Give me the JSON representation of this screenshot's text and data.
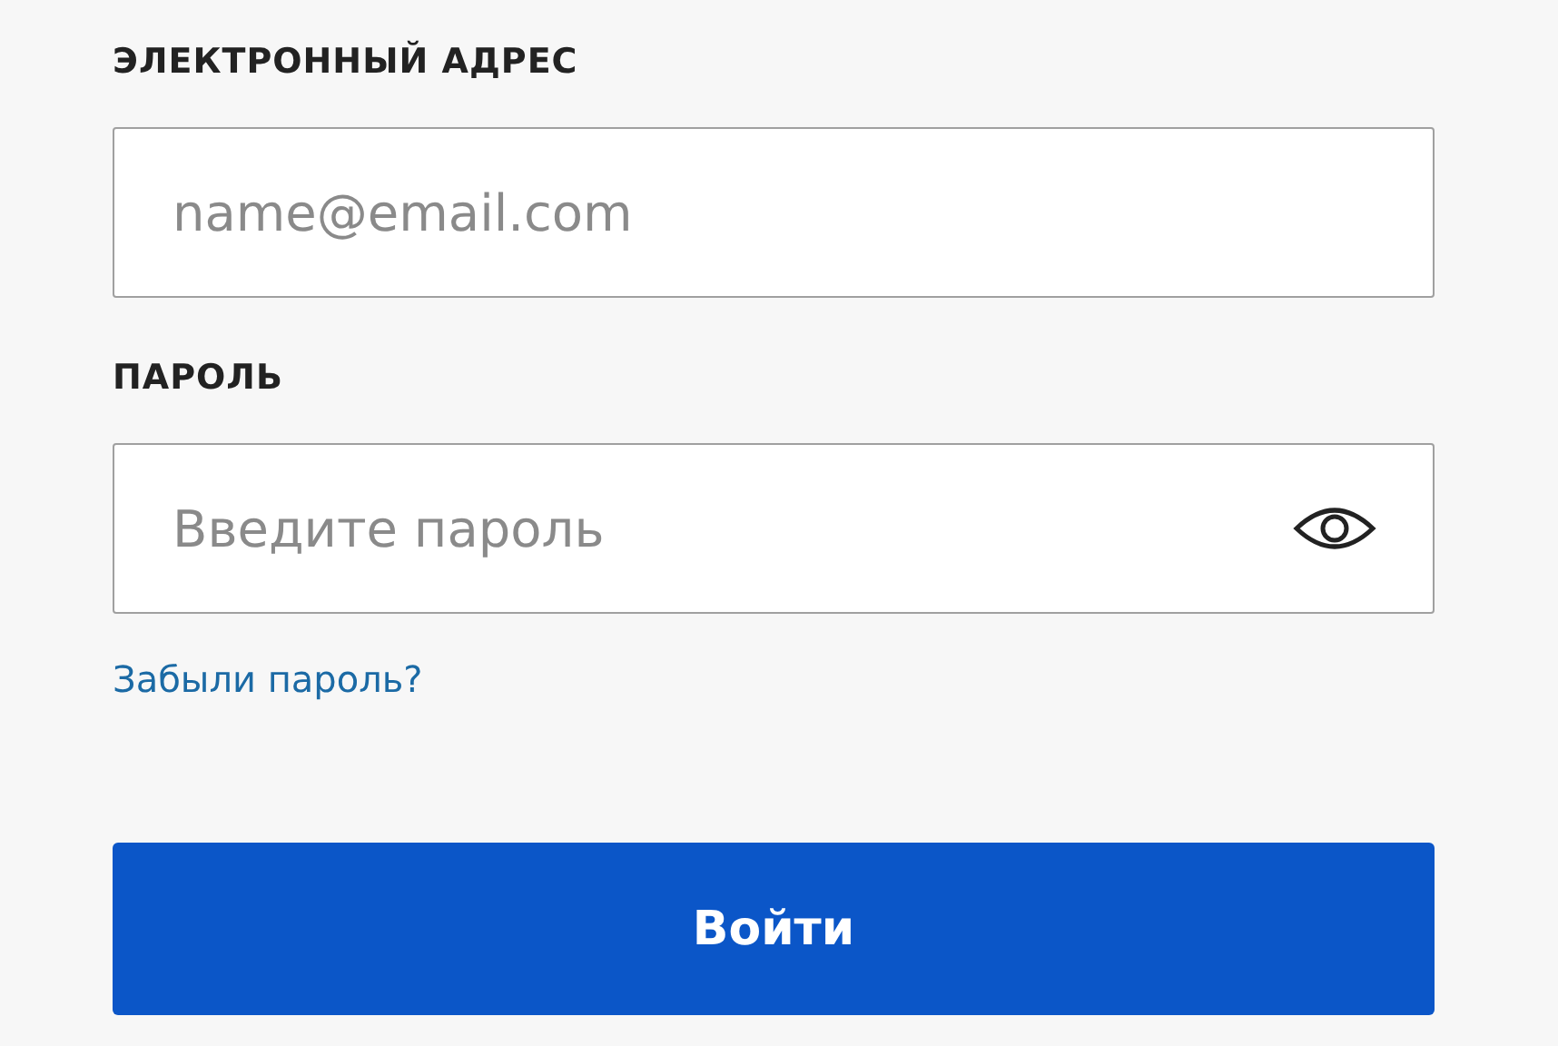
{
  "email": {
    "label": "ЭЛЕКТРОННЫЙ АДРЕС",
    "placeholder": "name@email.com"
  },
  "password": {
    "label": "ПАРОЛЬ",
    "placeholder": "Введите пароль"
  },
  "forgot_link": "Забыли пароль?",
  "submit_button": "Войти"
}
